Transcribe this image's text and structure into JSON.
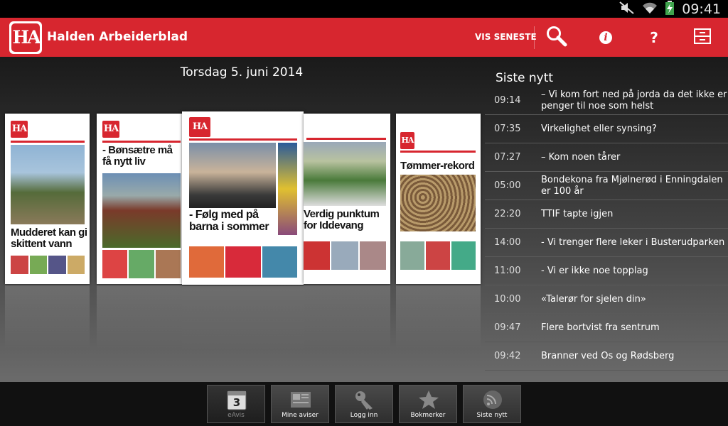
{
  "status_bar": {
    "time": "09:41",
    "icons": [
      "mute-icon",
      "wifi-icon",
      "battery-charging-icon"
    ]
  },
  "app_bar": {
    "logo_text": "HA",
    "title": "Halden Arbeiderblad",
    "vis_seneste_label": "VIS SENESTE",
    "actions": [
      "search-icon",
      "info-icon",
      "help-icon",
      "archive-icon"
    ],
    "info_glyph": "i",
    "help_glyph": "?"
  },
  "carousel": {
    "date": "Torsdag 5. juni 2014",
    "covers": [
      {
        "headline": "Mudderet kan gi skittent vann"
      },
      {
        "headline": "- Bønsætre må få nytt liv"
      },
      {
        "headline": "- Følg med på barna i sommer"
      },
      {
        "headline": "Verdig punktum for Iddevang"
      },
      {
        "headline": "Tømmer-rekord"
      }
    ]
  },
  "news": {
    "title": "Siste nytt",
    "items": [
      {
        "time": "09:14",
        "headline": "– Vi kom fort ned på jorda da det ikke er penger til noe som helst"
      },
      {
        "time": "07:35",
        "headline": "Virkelighet eller synsing?"
      },
      {
        "time": "07:27",
        "headline": "– Kom noen tårer"
      },
      {
        "time": "05:00",
        "headline": "Bondekona fra Mjølnerød i Enningdalen er 100 år"
      },
      {
        "time": "22:20",
        "headline": "TTIF tapte igjen"
      },
      {
        "time": "14:00",
        "headline": "- Vi trenger flere leker i Busterudparken"
      },
      {
        "time": "11:00",
        "headline": "- Vi er ikke noe topplag"
      },
      {
        "time": "10:00",
        "headline": "«Talerør for sjelen din»"
      },
      {
        "time": "09:47",
        "headline": "Flere bortvist fra sentrum"
      },
      {
        "time": "09:42",
        "headline": "Branner ved Os og Rødsberg"
      }
    ]
  },
  "bottom_nav": {
    "calendar_day": "3",
    "items": [
      {
        "label": "eAvis",
        "icon": "calendar-icon",
        "active": true
      },
      {
        "label": "Mine aviser",
        "icon": "newspaper-icon",
        "active": false
      },
      {
        "label": "Logg inn",
        "icon": "key-icon",
        "active": false
      },
      {
        "label": "Bokmerker",
        "icon": "star-icon",
        "active": false
      },
      {
        "label": "Siste nytt",
        "icon": "rss-icon",
        "active": false
      }
    ]
  },
  "colors": {
    "brand_red": "#d7262f",
    "bar_black": "#000000"
  }
}
